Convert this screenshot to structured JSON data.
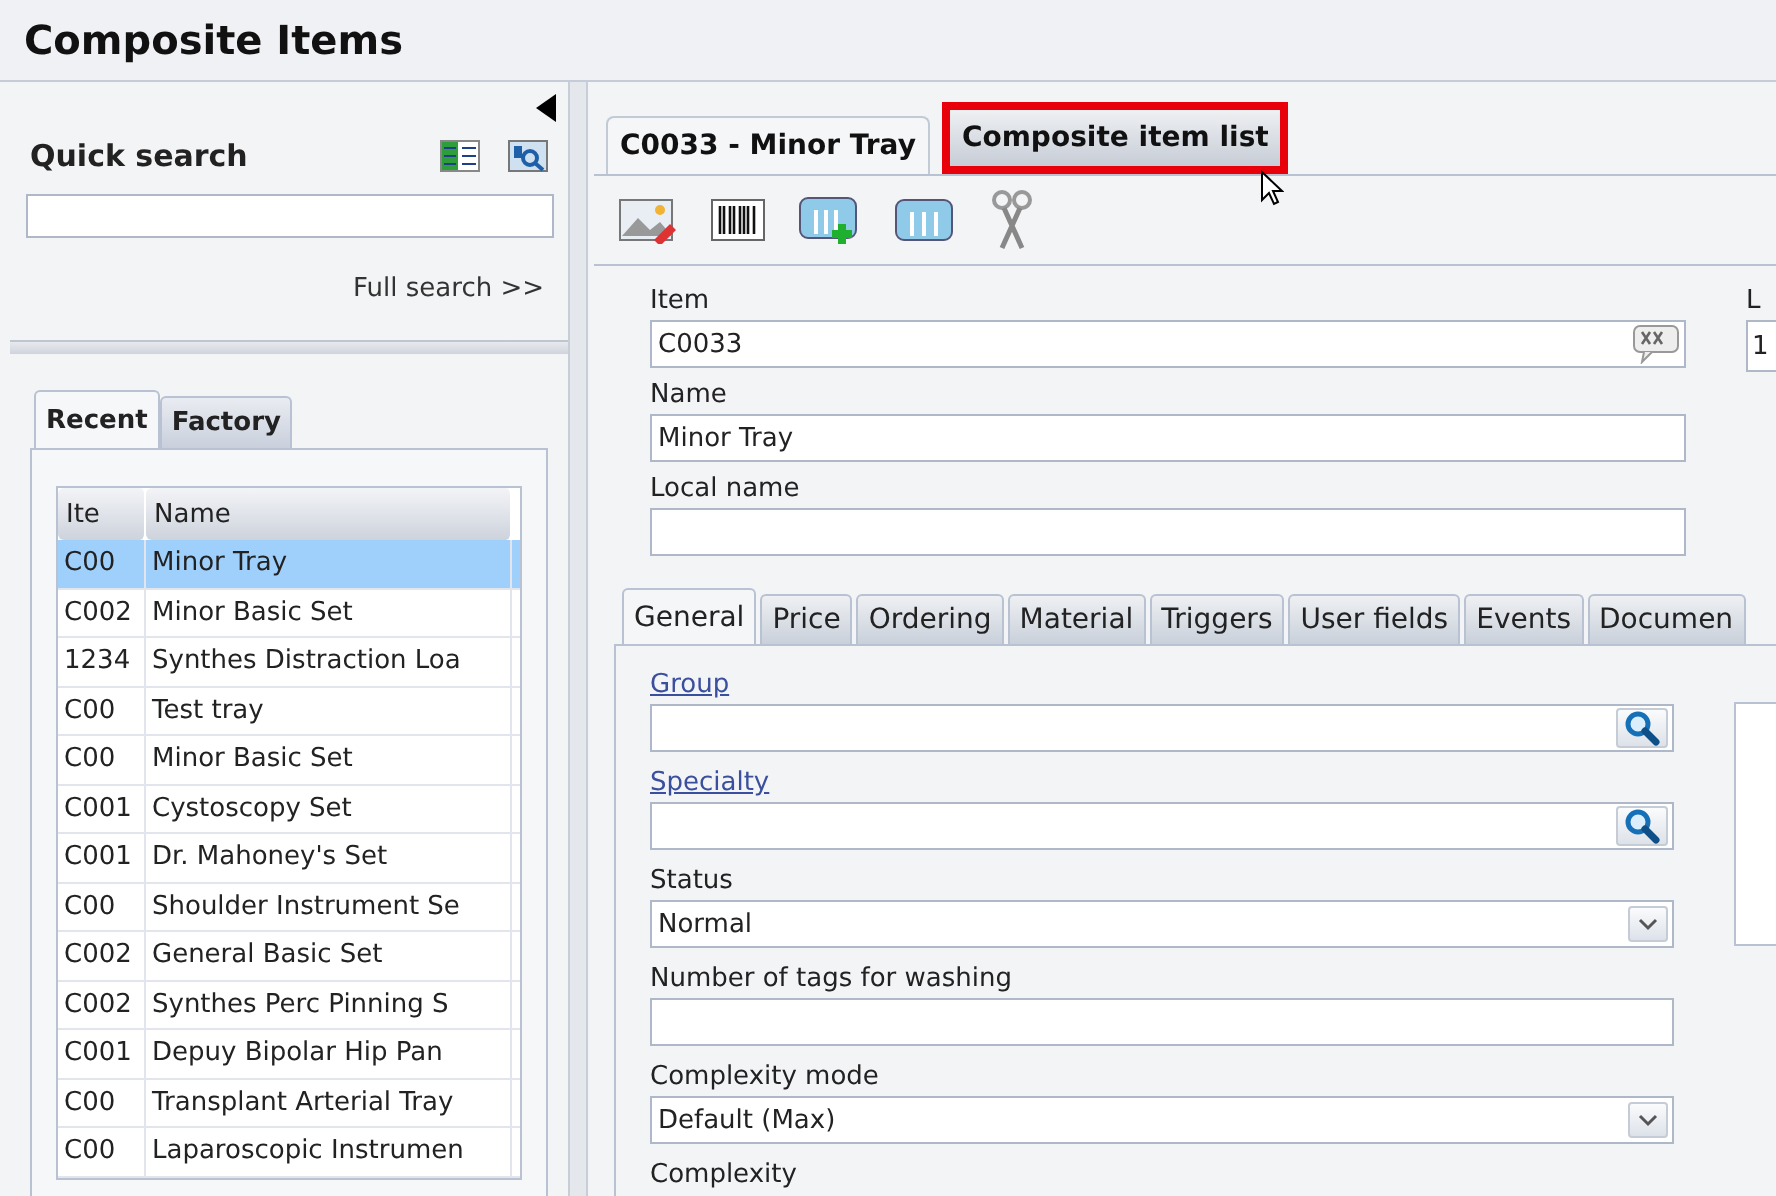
{
  "title": "Composite Items",
  "quick_search": {
    "heading": "Quick search",
    "link": "Full search >>"
  },
  "left_tabs": [
    {
      "label": "Recent",
      "selected": true
    },
    {
      "label": "Factory",
      "selected": false
    }
  ],
  "table": {
    "columns": [
      "Ite",
      "Name"
    ],
    "rows": [
      {
        "cells": [
          "C00",
          "Minor Tray"
        ],
        "selected": true
      },
      {
        "cells": [
          "C002",
          "Minor Basic Set"
        ],
        "selected": false
      },
      {
        "cells": [
          "1234",
          "Synthes Distraction Loa"
        ],
        "selected": false
      },
      {
        "cells": [
          "C00",
          "Test tray"
        ],
        "selected": false
      },
      {
        "cells": [
          "C00",
          "Minor Basic Set"
        ],
        "selected": false
      },
      {
        "cells": [
          "C001",
          "Cystoscopy Set"
        ],
        "selected": false
      },
      {
        "cells": [
          "C001",
          "Dr. Mahoney's Set"
        ],
        "selected": false
      },
      {
        "cells": [
          "C00",
          "Shoulder Instrument Se"
        ],
        "selected": false
      },
      {
        "cells": [
          "C002",
          "General Basic Set"
        ],
        "selected": false
      },
      {
        "cells": [
          "C002",
          "Synthes Perc Pinning S"
        ],
        "selected": false
      },
      {
        "cells": [
          "C001",
          "Depuy Bipolar Hip Pan"
        ],
        "selected": false
      },
      {
        "cells": [
          "C00",
          "Transplant Arterial Tray"
        ],
        "selected": false
      },
      {
        "cells": [
          "C00",
          "Laparoscopic Instrumen"
        ],
        "selected": false
      }
    ]
  },
  "main_tabs": [
    {
      "label": "C0033 - Minor Tray",
      "selected": true,
      "highlighted": false
    },
    {
      "label": "Composite item list",
      "selected": false,
      "highlighted": true
    }
  ],
  "item_fields": [
    {
      "kind": "code",
      "label": "Item",
      "value": "C0033"
    },
    {
      "kind": "text",
      "label": "Name",
      "value": "Minor Tray"
    },
    {
      "kind": "text",
      "label": "Local name"
    }
  ],
  "side_field": {
    "label": "L",
    "value": "1"
  },
  "detail_tabs": [
    {
      "label": "General",
      "selected": true
    },
    {
      "label": "Price",
      "selected": false
    },
    {
      "label": "Ordering",
      "selected": false
    },
    {
      "label": "Material",
      "selected": false
    },
    {
      "label": "Triggers",
      "selected": false
    },
    {
      "label": "User fields",
      "selected": false
    },
    {
      "label": "Events",
      "selected": false
    },
    {
      "label": "Documen",
      "selected": false
    }
  ],
  "general_fields": [
    {
      "kind": "lookup",
      "label": "Group"
    },
    {
      "kind": "lookup",
      "label": "Specialty"
    },
    {
      "kind": "select",
      "label": "Status",
      "value": "Normal"
    },
    {
      "kind": "text",
      "label": "Number of tags for washing"
    },
    {
      "kind": "select",
      "label": "Complexity mode",
      "value": "Default (Max)"
    },
    {
      "kind": "label",
      "label": "Complexity"
    }
  ]
}
